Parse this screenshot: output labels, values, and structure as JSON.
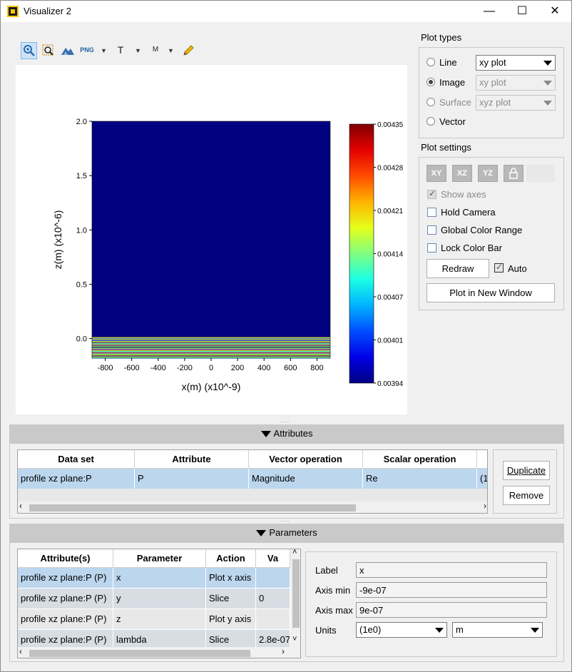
{
  "window": {
    "title": "Visualizer 2",
    "minimize": "—",
    "maximize": "☐",
    "close": "✕"
  },
  "toolbar": {
    "png_label": "PNG",
    "text_label": "T",
    "marker_label": "M"
  },
  "chart_data": {
    "type": "heatmap",
    "xlabel": "x(m) (x10^-9)",
    "ylabel": "z(m) (x10^-6)",
    "xlim": [
      -900,
      900
    ],
    "ylim": [
      -0.18,
      2.0
    ],
    "x_ticks": [
      "-800",
      "-600",
      "-400",
      "-200",
      "0",
      "200",
      "400",
      "600",
      "800"
    ],
    "x_tick_values": [
      -800,
      -600,
      -400,
      -200,
      0,
      200,
      400,
      600,
      800
    ],
    "y_ticks": [
      "0.0",
      "0.5",
      "1.0",
      "1.5",
      "2.0"
    ],
    "y_tick_values": [
      0.0,
      0.5,
      1.0,
      1.5,
      2.0
    ],
    "colorbar_ticks": [
      "0.00435",
      "0.00428",
      "0.00421",
      "0.00414",
      "0.00407",
      "0.00401",
      "0.00394"
    ],
    "colorbar_range": [
      0.00394,
      0.00435
    ],
    "background_value": 0.00394,
    "stripe_colors": [
      "#ffd200",
      "#00c8ff",
      "#ff3c00",
      "#5aff9a",
      "#0026ff",
      "#ff9900",
      "#3affb4",
      "#c80000",
      "#00e6ff",
      "#ffe600",
      "#0040ff",
      "#ff6600",
      "#00ffb0",
      "#800000",
      "#00b0ff",
      "#ffea00",
      "#2200ff",
      "#ff9a00",
      "#80ff70",
      "#00ffff",
      "#ff2000",
      "#3070ff",
      "#ffd000",
      "#00ff90",
      "#ff5000",
      "#0030e0",
      "#f0ff00",
      "#00c0ff"
    ]
  },
  "plot_types": {
    "title": "Plot types",
    "line": "Line",
    "line_select": "xy plot",
    "image": "Image",
    "image_select": "xy plot",
    "surface": "Surface",
    "surface_select": "xyz plot",
    "vector": "Vector"
  },
  "plot_settings": {
    "title": "Plot settings",
    "xy": "XY",
    "xz": "XZ",
    "yz": "YZ",
    "show_axes": "Show axes",
    "hold_camera": "Hold Camera",
    "global_color_range": "Global Color Range",
    "lock_color_bar": "Lock Color Bar",
    "redraw": "Redraw",
    "auto": "Auto",
    "plot_in_new_window": "Plot in New Window"
  },
  "attributes": {
    "header": "Attributes",
    "columns": [
      "Data set",
      "Attribute",
      "Vector operation",
      "Scalar operation"
    ],
    "row": [
      "profile xz plane:P",
      "P",
      "Magnitude",
      "Re",
      "(1"
    ],
    "duplicate": "Duplicate",
    "remove": "Remove"
  },
  "parameters": {
    "header": "Parameters",
    "columns": [
      "Attribute(s)",
      "Parameter",
      "Action",
      "Va"
    ],
    "rows": [
      [
        "profile xz plane:P (P)",
        "x",
        "Plot x axis",
        ""
      ],
      [
        "profile xz plane:P (P)",
        "y",
        "Slice",
        "0"
      ],
      [
        "profile xz plane:P (P)",
        "z",
        "Plot y axis",
        ""
      ],
      [
        "profile xz plane:P (P)",
        "lambda",
        "Slice",
        "2.8e-07"
      ]
    ],
    "label_label": "Label",
    "label_value": "x",
    "axis_min_label": "Axis min",
    "axis_min_value": "-9e-07",
    "axis_max_label": "Axis max",
    "axis_max_value": "9e-07",
    "units_label": "Units",
    "units_scale": "(1e0)",
    "units_unit": "m"
  }
}
